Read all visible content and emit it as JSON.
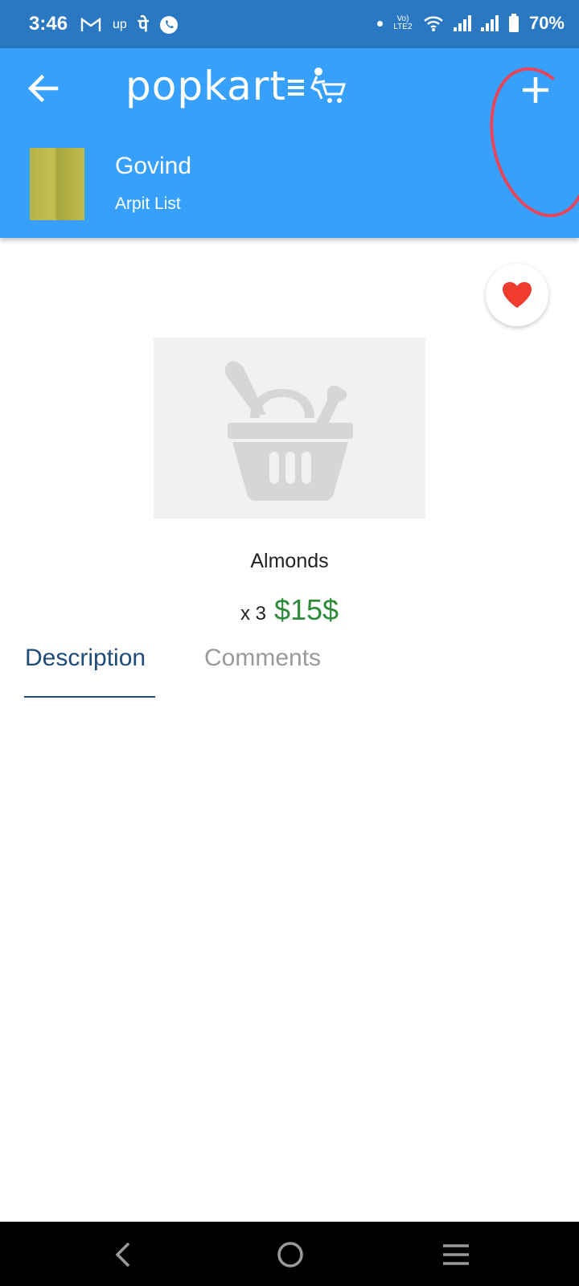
{
  "status_bar": {
    "time": "3:46",
    "indicators_left": [
      "gmail-icon",
      "up-icon",
      "phonepe-icon",
      "whatsapp-icon"
    ],
    "up_label": "up",
    "phonepe_label": "पे",
    "network_label": "Vo) LTE2",
    "battery": "70%"
  },
  "header": {
    "logo_text": "popkart",
    "user_name": "Govind",
    "list_name": "Arpit List",
    "bg_color": "#36a0fb"
  },
  "product": {
    "name": "Almonds",
    "quantity": "x 3",
    "price": "$15$",
    "price_color": "#2e8b3a"
  },
  "tabs": [
    {
      "label": "Description",
      "active": true
    },
    {
      "label": "Comments",
      "active": false
    }
  ],
  "colors": {
    "favorite": "#f03c2e",
    "annotation": "#e8445a",
    "tab_active": "#1e4b78"
  }
}
